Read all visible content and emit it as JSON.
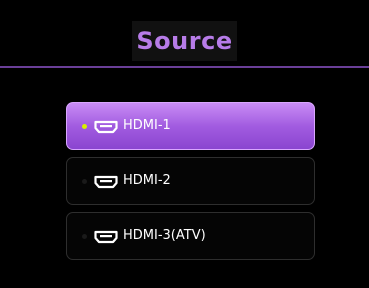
{
  "title": "Source",
  "sources": [
    {
      "label": "HDMI-1",
      "icon": "hdmi-port-icon",
      "selected": true
    },
    {
      "label": "HDMI-2",
      "icon": "hdmi-port-icon",
      "selected": false
    },
    {
      "label": "HDMI-3(ATV)",
      "icon": "hdmi-port-icon",
      "selected": false
    }
  ],
  "colors": {
    "title": "#b77ce8",
    "accent": "#a25ce0",
    "active_dot": "#d9f000",
    "background": "#000000"
  }
}
